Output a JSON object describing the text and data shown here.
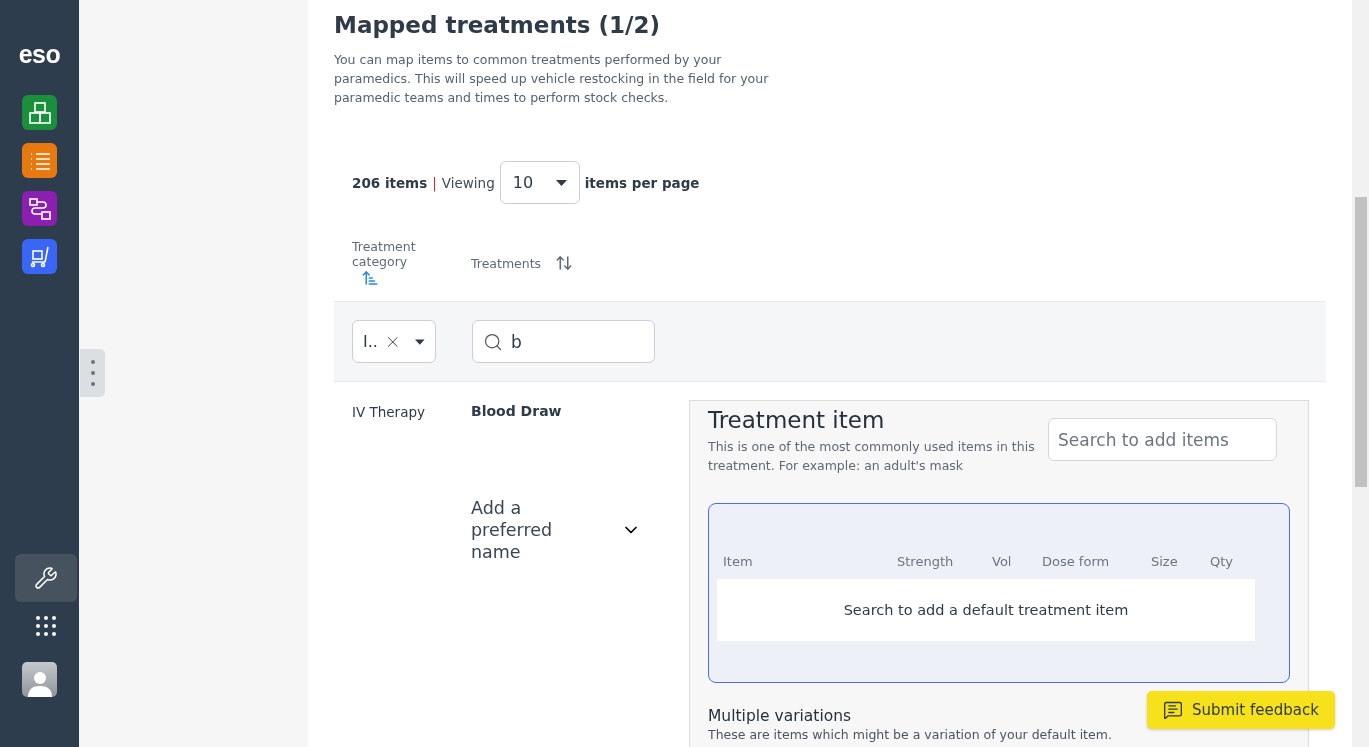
{
  "sidebar": {
    "logo": "eso",
    "apps": [
      {
        "kind": "boxes",
        "color": "#1a8f3c"
      },
      {
        "kind": "list",
        "color": "#e8790f"
      },
      {
        "kind": "flow",
        "color": "#8a1fb0"
      },
      {
        "kind": "cart",
        "color": "#3a66f5"
      }
    ],
    "tools": [
      {
        "kind": "wrench",
        "selected": true
      },
      {
        "kind": "grid",
        "selected": false
      }
    ]
  },
  "header": {
    "title": "Mapped treatments (1/2)",
    "description": "You can map items to common treatments performed by your paramedics. This will speed up vehicle restocking in the field for your paramedic teams and times to perform stock checks."
  },
  "pagination": {
    "count": "206 items",
    "separator": "|",
    "viewing": "Viewing",
    "per_page_value": "10",
    "per_page_label": "items per page"
  },
  "table": {
    "columns": [
      {
        "label": "Treatment category",
        "sorted": true
      },
      {
        "label": "Treatments",
        "sorted": false
      }
    ],
    "filters": {
      "category_value": "I..",
      "search_value": "b"
    },
    "rows": [
      {
        "category": "IV Therapy",
        "treatment": "Blood Draw",
        "preferred_name": "Add a preferred name",
        "expanded": false
      }
    ]
  },
  "treatment_item": {
    "title": "Treatment item",
    "description": "This is one of the most commonly used items in this treatment. For example: an adult's mask",
    "search_placeholder": "Search to add items",
    "columns": [
      "Item",
      "Strength",
      "Vol",
      "Dose form",
      "Size",
      "Qty"
    ],
    "empty_message": "Search to add a default treatment item"
  },
  "variations": {
    "title": "Multiple variations",
    "description": "These are items which might be a variation of your default item."
  },
  "feedback_button": "Submit feedback"
}
